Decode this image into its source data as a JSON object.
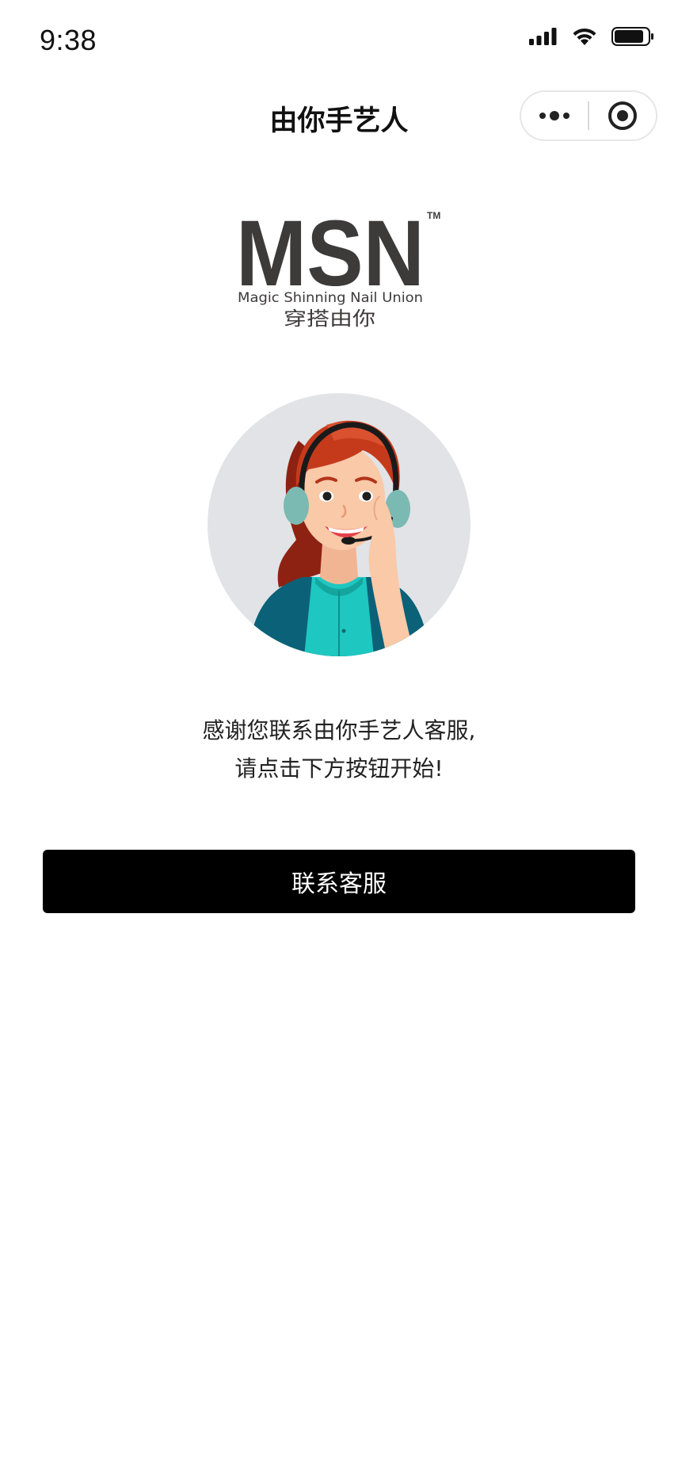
{
  "status_bar": {
    "time": "9:38",
    "icons": [
      "cellular-signal-icon",
      "wifi-icon",
      "battery-icon"
    ]
  },
  "nav": {
    "title": "由你手艺人",
    "capsule_icons": [
      "more-dots-icon",
      "close-target-icon"
    ]
  },
  "logo": {
    "brand": "MSN",
    "trademark": "TM",
    "tagline": "Magic Shinning Nail Union",
    "slogan": "穿搭由你"
  },
  "message": {
    "line1": "感谢您联系由你手艺人客服,",
    "line2": "请点击下方按钮开始!"
  },
  "contact_button": {
    "label": "联系客服"
  },
  "colors": {
    "button_bg": "#000000",
    "button_text": "#ffffff",
    "logo_text": "#3d3a3a",
    "avatar_bg": "#e1e3e6"
  }
}
